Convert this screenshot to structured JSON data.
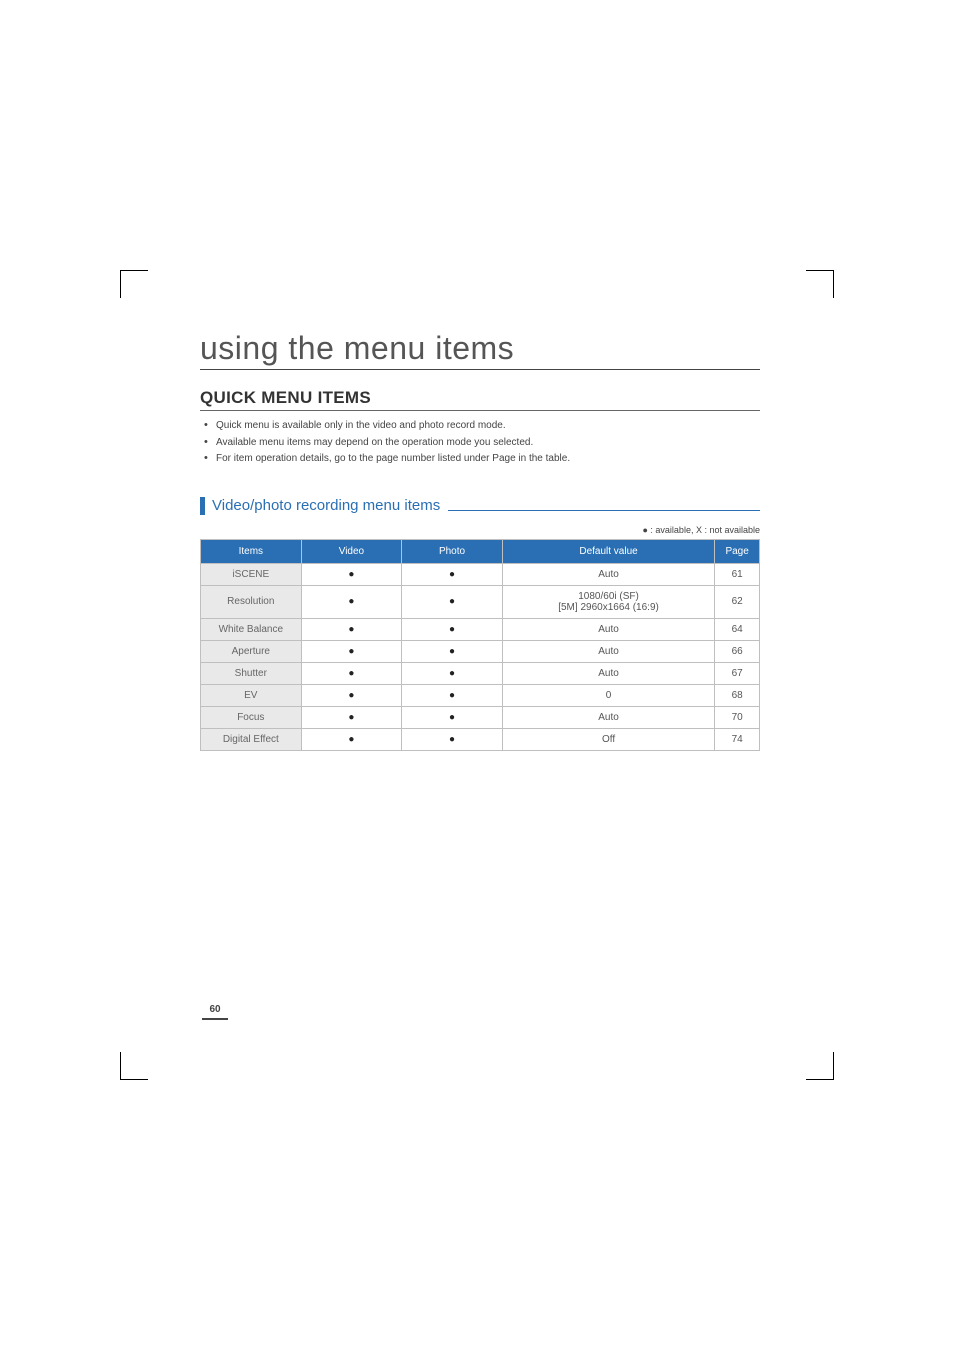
{
  "chapter_title": "using the menu items",
  "section_heading": "QUICK MENU ITEMS",
  "bullets": [
    "Quick menu is available only in the video and photo record mode.",
    "Available menu items may depend on the operation mode you selected.",
    "For item operation details, go to the page number listed under Page in the table."
  ],
  "subsection_title": "Video/photo recording menu items",
  "legend": "● : available, X : not available",
  "table": {
    "headers": {
      "items": "Items",
      "video": "Video",
      "photo": "Photo",
      "default": "Default value",
      "page": "Page"
    },
    "rows": [
      {
        "item": "iSCENE",
        "video": "●",
        "photo": "●",
        "default": "Auto",
        "page": "61"
      },
      {
        "item": "Resolution",
        "video": "●",
        "photo": "●",
        "default": "1080/60i (SF)\n[5M] 2960x1664 (16:9)",
        "page": "62"
      },
      {
        "item": "White Balance",
        "video": "●",
        "photo": "●",
        "default": "Auto",
        "page": "64"
      },
      {
        "item": "Aperture",
        "video": "●",
        "photo": "●",
        "default": "Auto",
        "page": "66"
      },
      {
        "item": "Shutter",
        "video": "●",
        "photo": "●",
        "default": "Auto",
        "page": "67"
      },
      {
        "item": "EV",
        "video": "●",
        "photo": "●",
        "default": "0",
        "page": "68"
      },
      {
        "item": "Focus",
        "video": "●",
        "photo": "●",
        "default": "Auto",
        "page": "70"
      },
      {
        "item": "Digital Effect",
        "video": "●",
        "photo": "●",
        "default": "Off",
        "page": "74"
      }
    ]
  },
  "page_number": "60"
}
